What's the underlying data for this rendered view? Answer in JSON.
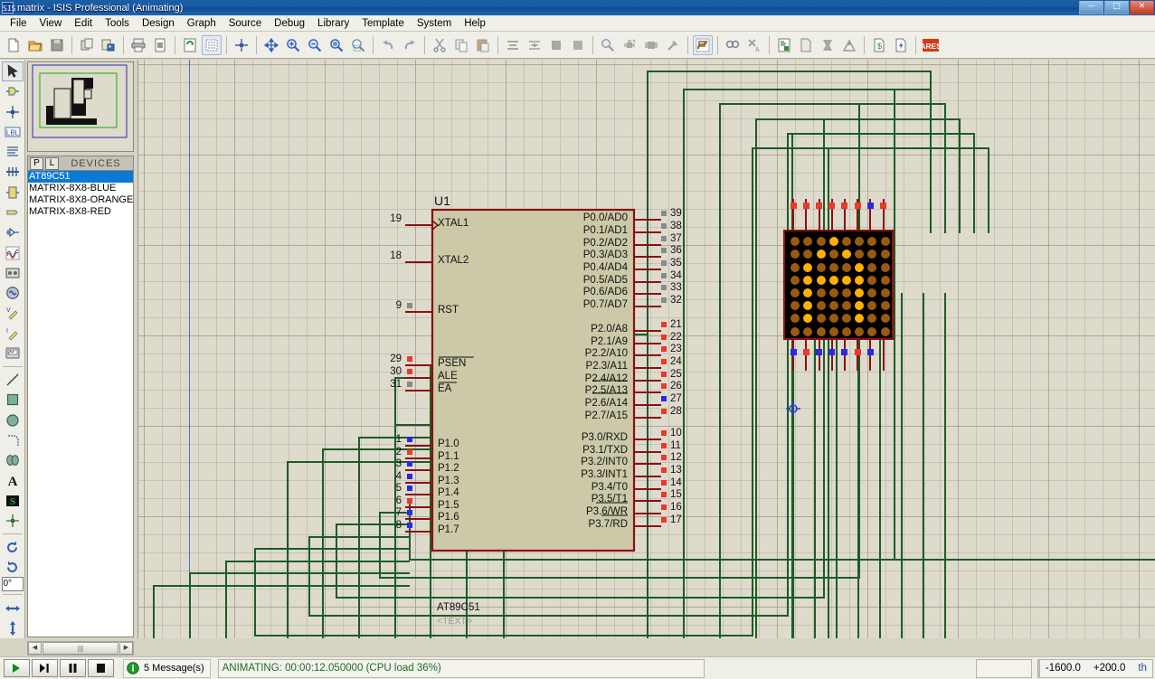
{
  "window": {
    "title": "matrix - ISIS Professional (Animating)",
    "icon": "isis-app-icon",
    "buttons": [
      {
        "name": "minimize",
        "glyph": "—"
      },
      {
        "name": "maximize",
        "glyph": "□"
      },
      {
        "name": "close",
        "glyph": "✕"
      }
    ]
  },
  "menubar": {
    "items": [
      "File",
      "View",
      "Edit",
      "Tools",
      "Design",
      "Graph",
      "Source",
      "Debug",
      "Library",
      "Template",
      "System",
      "Help"
    ]
  },
  "toolbar": {
    "groups": [
      [
        "new-file-icon",
        "open-file-icon",
        "save-file-icon"
      ],
      [
        "import-section-icon",
        "export-section-icon"
      ],
      [
        "print-icon",
        "print-area-icon"
      ],
      [
        "refresh-display-icon",
        "toggle-grid-icon"
      ],
      [
        "origin-icon"
      ],
      [
        "pan-icon",
        "zoom-in-icon",
        "zoom-out-icon",
        "zoom-all-icon",
        "zoom-area-icon"
      ],
      [
        "undo-icon",
        "redo-icon"
      ],
      [
        "cut-icon",
        "copy-icon",
        "paste-icon"
      ],
      [
        "block-copy-icon",
        "block-move-icon",
        "block-rotate-icon",
        "block-delete-icon"
      ],
      [
        "pick-device-icon",
        "make-device-icon",
        "package-tool-icon",
        "decompose-icon"
      ],
      [
        "wire-autorouter-icon"
      ],
      [
        "search-tag-icon",
        "property-assign-icon"
      ],
      [
        "design-explorer-icon",
        "new-sheet-icon",
        "remove-sheet-icon",
        "exit-sheet-icon"
      ],
      [
        "bill-of-materials-icon",
        "electrical-rule-check-icon"
      ],
      [
        "ares-netlist-icon"
      ]
    ]
  },
  "palette": {
    "tools": [
      {
        "name": "selection-mode",
        "selected": true
      },
      {
        "name": "component-mode",
        "selected": false
      },
      {
        "name": "junction-dot-mode",
        "selected": false
      },
      {
        "name": "wire-label-mode",
        "selected": false
      },
      {
        "name": "text-script-mode",
        "selected": false
      },
      {
        "name": "bus-mode",
        "selected": false
      },
      {
        "name": "subcircuit-mode",
        "selected": false
      },
      {
        "name": "terminals-mode",
        "selected": false
      },
      {
        "name": "device-pin-mode",
        "selected": false
      },
      {
        "name": "graph-mode",
        "selected": false
      },
      {
        "name": "tape-recorder-mode",
        "selected": false
      },
      {
        "name": "generator-mode",
        "selected": false
      },
      {
        "name": "voltage-probe-mode",
        "selected": false
      },
      {
        "name": "current-probe-mode",
        "selected": false
      },
      {
        "name": "virtual-instrument-mode",
        "selected": false
      },
      {
        "name": "2d-line-mode",
        "selected": false
      },
      {
        "name": "2d-box-mode",
        "selected": false
      },
      {
        "name": "2d-circle-mode",
        "selected": false
      },
      {
        "name": "2d-arc-mode",
        "selected": false
      },
      {
        "name": "2d-path-mode",
        "selected": false
      },
      {
        "name": "2d-text-mode",
        "selected": false
      },
      {
        "name": "2d-symbol-mode",
        "selected": false
      },
      {
        "name": "2d-marker-mode",
        "selected": false
      }
    ],
    "rotation_value": "0°",
    "rotate-clockwise": "rotate-cw-icon",
    "rotate-anticlockwise": "rotate-ccw-icon",
    "mirror-horizontal": "mirror-x-icon",
    "mirror-vertical": "mirror-y-icon"
  },
  "object_selector": {
    "buttons": [
      {
        "label": "P",
        "name": "pick-devices"
      },
      {
        "label": "L",
        "name": "library-manager"
      }
    ],
    "title": "DEVICES",
    "devices": [
      {
        "label": "AT89C51",
        "selected": true
      },
      {
        "label": "MATRIX-8X8-BLUE",
        "selected": false
      },
      {
        "label": "MATRIX-8X8-ORANGE",
        "selected": false
      },
      {
        "label": "MATRIX-8X8-RED",
        "selected": false
      }
    ]
  },
  "schematic": {
    "component": {
      "reference": "U1",
      "value": "AT89C51",
      "text_placeholder": "<TEXT>"
    },
    "pins_left": [
      {
        "num": "19",
        "label": "XTAL1",
        "state": "none",
        "clock": true
      },
      {
        "num": "18",
        "label": "XTAL2",
        "state": "none",
        "clock": false
      },
      {
        "num": "9",
        "label": "RST",
        "state": "low",
        "clock": false
      },
      {
        "num": "29",
        "label": "PSEN",
        "state": "high",
        "clock": false,
        "overline": true
      },
      {
        "num": "30",
        "label": "ALE",
        "state": "high",
        "clock": false,
        "overline": true
      },
      {
        "num": "31",
        "label": "EA",
        "state": "low",
        "clock": false,
        "overline": true
      }
    ],
    "pins_p1": [
      {
        "num": "1",
        "label": "P1.0",
        "state": "blue"
      },
      {
        "num": "2",
        "label": "P1.1",
        "state": "red"
      },
      {
        "num": "3",
        "label": "P1.2",
        "state": "blue"
      },
      {
        "num": "4",
        "label": "P1.3",
        "state": "blue"
      },
      {
        "num": "5",
        "label": "P1.4",
        "state": "blue"
      },
      {
        "num": "6",
        "label": "P1.5",
        "state": "red"
      },
      {
        "num": "7",
        "label": "P1.6",
        "state": "blue"
      },
      {
        "num": "8",
        "label": "P1.7",
        "state": "blue"
      }
    ],
    "pins_p0": [
      {
        "num": "39",
        "label": "P0.0/AD0",
        "state": "grey"
      },
      {
        "num": "38",
        "label": "P0.1/AD1",
        "state": "grey"
      },
      {
        "num": "37",
        "label": "P0.2/AD2",
        "state": "grey"
      },
      {
        "num": "36",
        "label": "P0.3/AD3",
        "state": "grey"
      },
      {
        "num": "35",
        "label": "P0.4/AD4",
        "state": "grey"
      },
      {
        "num": "34",
        "label": "P0.5/AD5",
        "state": "grey"
      },
      {
        "num": "33",
        "label": "P0.6/AD6",
        "state": "grey"
      },
      {
        "num": "32",
        "label": "P0.7/AD7",
        "state": "grey"
      }
    ],
    "pins_p2": [
      {
        "num": "21",
        "label": "P2.0/A8",
        "state": "red"
      },
      {
        "num": "22",
        "label": "P2.1/A9",
        "state": "red"
      },
      {
        "num": "23",
        "label": "P2.2/A10",
        "state": "red"
      },
      {
        "num": "24",
        "label": "P2.3/A11",
        "state": "red"
      },
      {
        "num": "25",
        "label": "P2.4/A12",
        "state": "red"
      },
      {
        "num": "26",
        "label": "P2.5/A13",
        "state": "red"
      },
      {
        "num": "27",
        "label": "P2.6/A14",
        "state": "blue"
      },
      {
        "num": "28",
        "label": "P2.7/A15",
        "state": "red"
      }
    ],
    "pins_p3": [
      {
        "num": "10",
        "label": "P3.0/RXD",
        "state": "red"
      },
      {
        "num": "11",
        "label": "P3.1/TXD",
        "state": "red"
      },
      {
        "num": "12",
        "label": "P3.2/INT0",
        "state": "red",
        "overline_from": 5
      },
      {
        "num": "13",
        "label": "P3.3/INT1",
        "state": "red",
        "overline_from": 5
      },
      {
        "num": "14",
        "label": "P3.4/T0",
        "state": "red"
      },
      {
        "num": "15",
        "label": "P3.5/T1",
        "state": "red"
      },
      {
        "num": "16",
        "label": "P3.6/WR",
        "state": "red",
        "overline_from": 5
      },
      {
        "num": "17",
        "label": "P3.7/RD",
        "state": "red",
        "overline_from": 5
      }
    ],
    "matrix": {
      "name": "MATRIX-8X8-ORANGE",
      "rows": 8,
      "cols": 8,
      "top_pin_states": [
        "red",
        "red",
        "red",
        "red",
        "red",
        "red",
        "blue",
        "red"
      ],
      "bottom_pin_states": [
        "blue",
        "red",
        "blue",
        "blue",
        "blue",
        "red",
        "blue",
        ""
      ],
      "lit_color": "#ffb000",
      "dim_color": "#9a5a10",
      "body_color": "#000000",
      "border_color": "#8a1010",
      "pattern": [
        [
          0,
          0,
          0,
          1,
          0,
          0,
          0,
          0
        ],
        [
          0,
          0,
          1,
          0,
          1,
          0,
          0,
          0
        ],
        [
          0,
          1,
          0,
          0,
          0,
          1,
          0,
          0
        ],
        [
          0,
          1,
          1,
          1,
          1,
          1,
          0,
          0
        ],
        [
          0,
          1,
          0,
          0,
          0,
          1,
          0,
          0
        ],
        [
          0,
          1,
          0,
          0,
          0,
          1,
          0,
          0
        ],
        [
          0,
          1,
          0,
          0,
          0,
          1,
          0,
          0
        ],
        [
          0,
          0,
          0,
          0,
          0,
          0,
          0,
          0
        ]
      ]
    },
    "wire_color": "#1c5c26",
    "body_fill": "#ccc9a8",
    "body_stroke": "#8a1010",
    "cursor_marker": "crosshair-cursor"
  },
  "statusbar": {
    "animation_controls": [
      {
        "name": "play-button",
        "glyph": "play"
      },
      {
        "name": "step-button",
        "glyph": "step"
      },
      {
        "name": "pause-button",
        "glyph": "pause"
      },
      {
        "name": "stop-button",
        "glyph": "stop"
      }
    ],
    "messages": "5 Message(s)",
    "messages_icon": "info-icon",
    "animation_status": "ANIMATING: 00:00:12.050000 (CPU load 36%)",
    "coord_x": "-1600.0",
    "coord_y": "+200.0",
    "coord_units": "th"
  }
}
